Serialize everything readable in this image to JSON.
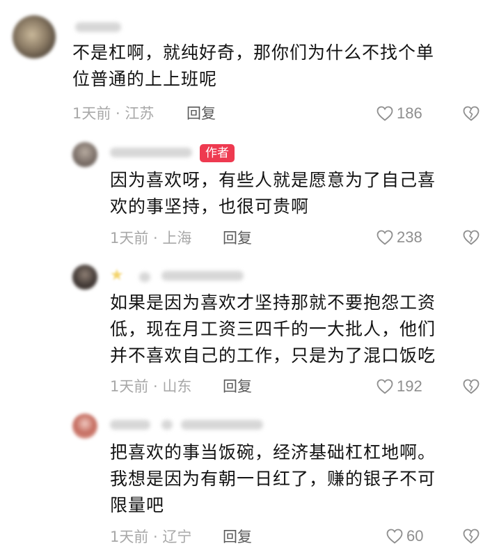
{
  "comments": [
    {
      "text_lines": [
        "不是杠啊，就纯好奇，那你们为什么不找个单",
        "位普通的上上班呢"
      ],
      "meta": "1天前 · 江苏",
      "reply_label": "回复",
      "likes": "186"
    },
    {
      "badge": "作者",
      "text_lines": [
        "因为喜欢呀，有些人就是愿意为了自己喜",
        "欢的事坚持，也很可贵啊"
      ],
      "meta": "1天前 · 上海",
      "reply_label": "回复",
      "likes": "238"
    },
    {
      "text_lines": [
        "如果是因为喜欢才坚持那就不要抱怨工资",
        "低，现在月工资三四千的一大批人，他们",
        "并不喜欢自己的工作，只是为了混口饭吃"
      ],
      "meta": "1天前 · 山东",
      "reply_label": "回复",
      "likes": "192"
    },
    {
      "text_lines": [
        "把喜欢的事当饭碗，经济基础杠杠地啊。",
        "我想是因为有朝一日红了，赚的银子不可",
        "限量吧"
      ],
      "meta": "1天前 · 辽宁",
      "reply_label": "回复",
      "likes": "60"
    }
  ],
  "icons": {
    "like": "heart-outline-icon",
    "dislike": "broken-heart-icon"
  },
  "colors": {
    "author_badge": "#ee3a50",
    "meta_text": "#a8a8a8",
    "reply_text": "#5a5a5a",
    "icon_stroke": "#8e8e8e"
  }
}
